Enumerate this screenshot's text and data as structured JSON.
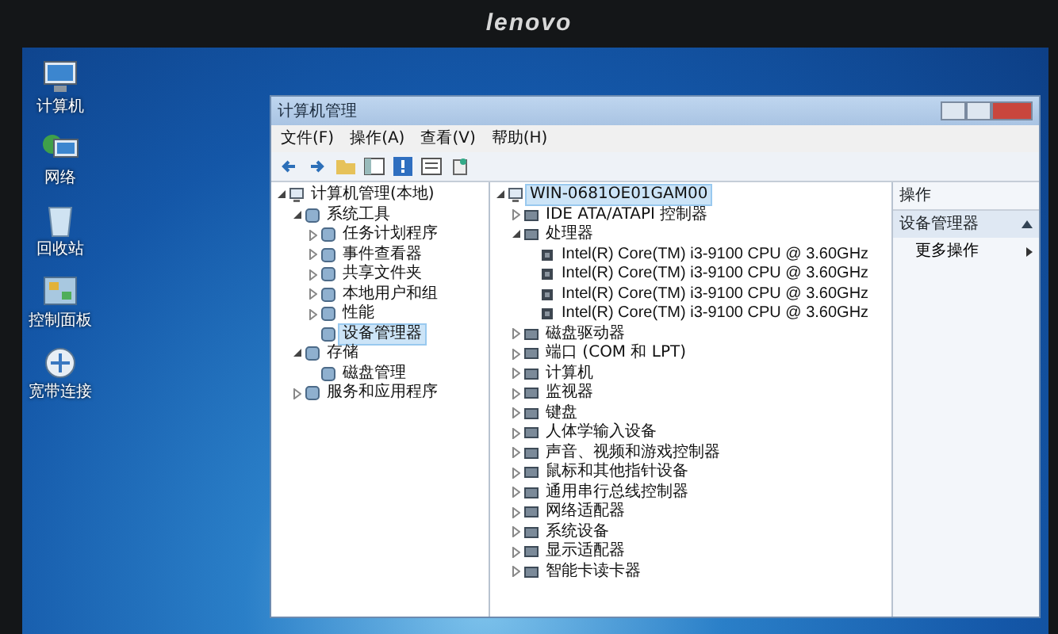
{
  "monitor": {
    "brand": "lenovo"
  },
  "desktop_icons": [
    {
      "label": "计算机"
    },
    {
      "label": "网络"
    },
    {
      "label": "回收站"
    },
    {
      "label": "控制面板"
    },
    {
      "label": "宽带连接"
    }
  ],
  "window": {
    "title": "计算机管理",
    "menu": [
      "文件(F)",
      "操作(A)",
      "查看(V)",
      "帮助(H)"
    ],
    "tree": [
      {
        "label": "计算机管理(本地)",
        "selected": false,
        "expanded": true,
        "children": [
          {
            "label": "系统工具",
            "selected": false,
            "expanded": true,
            "children": [
              {
                "label": "任务计划程序",
                "selected": false,
                "expanded": false
              },
              {
                "label": "事件查看器",
                "selected": false,
                "expanded": false
              },
              {
                "label": "共享文件夹",
                "selected": false,
                "expanded": false
              },
              {
                "label": "本地用户和组",
                "selected": false,
                "expanded": false
              },
              {
                "label": "性能",
                "selected": false,
                "expanded": false
              },
              {
                "label": "设备管理器",
                "selected": true
              }
            ]
          },
          {
            "label": "存储",
            "selected": false,
            "expanded": true,
            "children": [
              {
                "label": "磁盘管理",
                "selected": false
              }
            ]
          },
          {
            "label": "服务和应用程序",
            "selected": false,
            "expanded": false
          }
        ]
      }
    ],
    "devices": [
      {
        "label": "WIN-0681OE01GAM00",
        "selected": true,
        "expanded": true,
        "children": [
          {
            "label": "IDE ATA/ATAPI 控制器",
            "selected": false,
            "expanded": false
          },
          {
            "label": "处理器",
            "selected": false,
            "expanded": true,
            "children": [
              {
                "label": "Intel(R) Core(TM) i3-9100 CPU @ 3.60GHz",
                "selected": false
              },
              {
                "label": "Intel(R) Core(TM) i3-9100 CPU @ 3.60GHz",
                "selected": false
              },
              {
                "label": "Intel(R) Core(TM) i3-9100 CPU @ 3.60GHz",
                "selected": false
              },
              {
                "label": "Intel(R) Core(TM) i3-9100 CPU @ 3.60GHz",
                "selected": false
              }
            ]
          },
          {
            "label": "磁盘驱动器",
            "selected": false,
            "expanded": false
          },
          {
            "label": "端口 (COM 和 LPT)",
            "selected": false,
            "expanded": false
          },
          {
            "label": "计算机",
            "selected": false,
            "expanded": false
          },
          {
            "label": "监视器",
            "selected": false,
            "expanded": false
          },
          {
            "label": "键盘",
            "selected": false,
            "expanded": false
          },
          {
            "label": "人体学输入设备",
            "selected": false,
            "expanded": false
          },
          {
            "label": "声音、视频和游戏控制器",
            "selected": false,
            "expanded": false
          },
          {
            "label": "鼠标和其他指针设备",
            "selected": false,
            "expanded": false
          },
          {
            "label": "通用串行总线控制器",
            "selected": false,
            "expanded": false
          },
          {
            "label": "网络适配器",
            "selected": false,
            "expanded": false
          },
          {
            "label": "系统设备",
            "selected": false,
            "expanded": false
          },
          {
            "label": "显示适配器",
            "selected": false,
            "expanded": false
          },
          {
            "label": "智能卡读卡器",
            "selected": false,
            "expanded": false
          }
        ]
      }
    ],
    "actions": {
      "header": "操作",
      "section": "设备管理器",
      "items": [
        "更多操作"
      ]
    }
  }
}
